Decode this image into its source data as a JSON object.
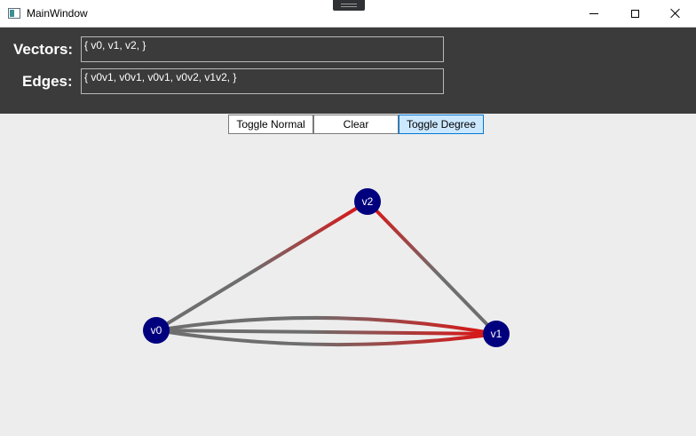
{
  "window": {
    "title": "MainWindow"
  },
  "header": {
    "vectors_label": "Vectors:",
    "vectors_value": "{ v0, v1, v2, }",
    "edges_label": "Edges:",
    "edges_value": "{ v0v1, v0v1, v0v1, v0v2, v1v2, }"
  },
  "toolbar": {
    "toggle_normal": "Toggle Normal",
    "clear": "Clear",
    "toggle_degree": "Toggle Degree"
  },
  "graph": {
    "nodes": [
      {
        "id": "v0",
        "label": "v0"
      },
      {
        "id": "v1",
        "label": "v1"
      },
      {
        "id": "v2",
        "label": "v2"
      }
    ],
    "edges": [
      "v0v1",
      "v0v1",
      "v0v1",
      "v0v2",
      "v1v2"
    ],
    "node_color": "#00007f",
    "edge_color_start": "#6e6e6e",
    "edge_color_end": "#e01010"
  },
  "colors": {
    "header_bg": "#3b3b3b",
    "canvas_bg": "#ededed",
    "selected_button": "#cce8ff"
  }
}
